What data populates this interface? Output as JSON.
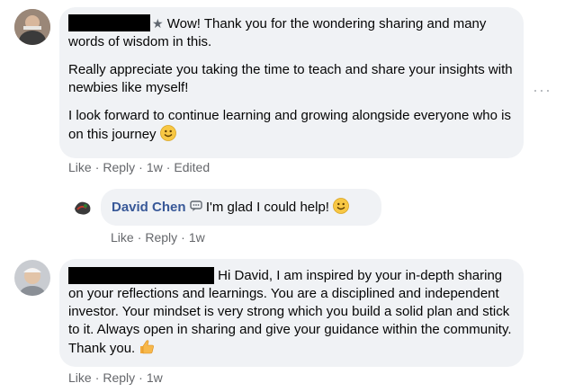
{
  "comment1": {
    "badge_icon": "star-icon",
    "paragraphs": [
      "Wow! Thank you for the wondering sharing and many words of wisdom in this.",
      "Really appreciate you taking the time to teach and share your insights with newbies like myself!",
      "I look forward to continue learning and growing alongside everyone who is on this journey"
    ],
    "paragraph3_emoji": "smiley-emoji",
    "actions": {
      "like": "Like",
      "reply": "Reply",
      "time": "1w",
      "edited": "Edited"
    }
  },
  "reply1": {
    "author": "David Chen",
    "badge_icon": "speech-bubble-icon",
    "text": "I'm glad I could help!",
    "emoji": "smiley-emoji",
    "actions": {
      "like": "Like",
      "reply": "Reply",
      "time": "1w"
    }
  },
  "comment2": {
    "text": "Hi David, I am inspired by your in-depth sharing on your reflections and learnings. You are a disciplined and independent investor. Your mindset is very strong which you build a solid plan and stick to it. Always open in sharing and give your guidance within the community. Thank you.",
    "emoji": "thumbs-up-emoji",
    "actions": {
      "like": "Like",
      "reply": "Reply",
      "time": "1w"
    }
  },
  "more_options_icon": "more-horizontal-icon",
  "colors": {
    "bubble": "#f0f2f5",
    "author": "#385898",
    "meta": "#65676b",
    "redaction": "#000000"
  }
}
